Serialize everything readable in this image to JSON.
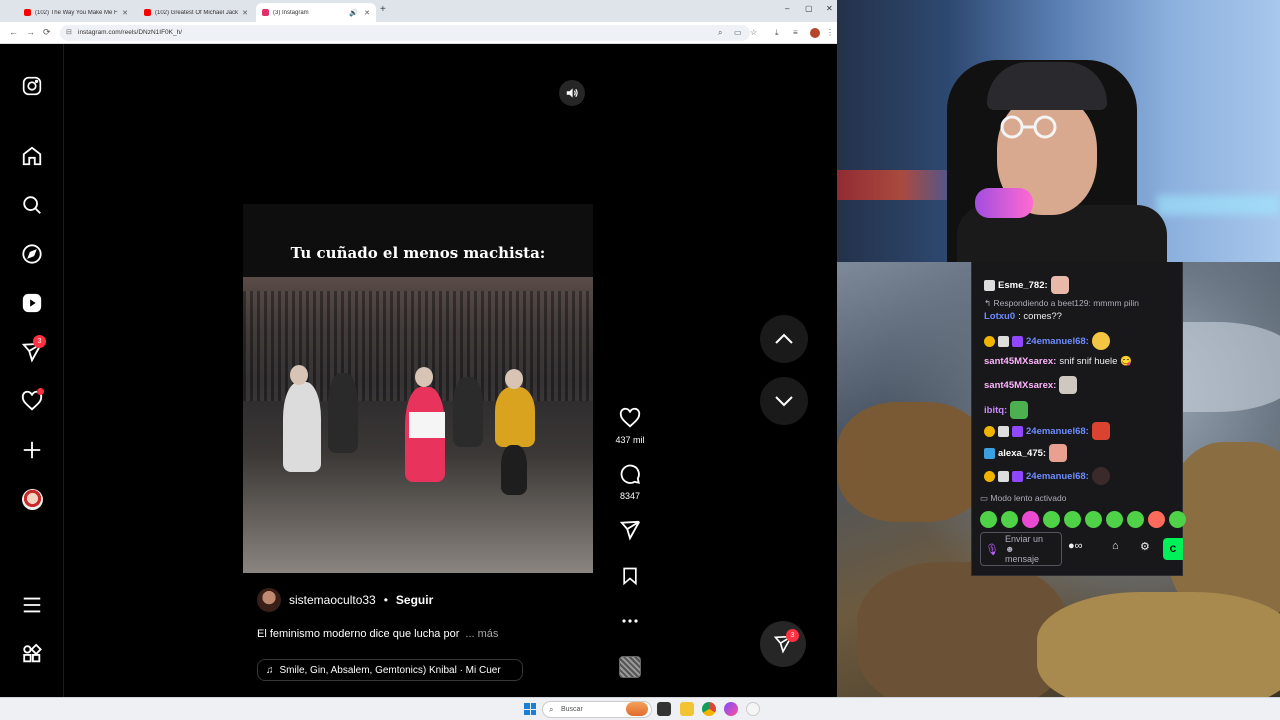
{
  "browser": {
    "tabs": [
      {
        "title": "(102) The Way You Make Me Fe",
        "color": "#ff0000",
        "active": false
      },
      {
        "title": "(102) Greatest Of Michael Jackso",
        "color": "#ff0000",
        "active": false
      },
      {
        "title": "(3) Instagram",
        "color": "#e1306c",
        "active": true
      }
    ],
    "new_tab": "+",
    "window_controls": {
      "minimize": "–",
      "maximize": "▢",
      "close": "✕"
    },
    "url": "instagram.com/reels/DNzN1IF0K_h/"
  },
  "instagram": {
    "nav": [
      {
        "name": "instagram-logo-icon"
      },
      {
        "name": "home-icon"
      },
      {
        "name": "search-icon"
      },
      {
        "name": "explore-icon"
      },
      {
        "name": "reels-icon"
      },
      {
        "name": "messages-icon",
        "badge": "3"
      },
      {
        "name": "notifications-icon"
      },
      {
        "name": "create-icon"
      },
      {
        "name": "profile-avatar"
      },
      {
        "name": "more-menu-icon"
      },
      {
        "name": "also-from-meta-icon"
      }
    ],
    "reel": {
      "overlay_title": "Tu cuñado el menos machista:",
      "author": "sistemaoculto33",
      "separator": "•",
      "follow_label": "Seguir",
      "description": "El feminismo moderno dice que lucha por",
      "more_label": "... más",
      "audio_label": "Smile, Gin, Absalem, Gemtonics)  Knibal · Mi Cuer"
    },
    "actions": {
      "likes": "437 mil",
      "comments": "8347"
    },
    "floating_messages_badge": "3"
  },
  "stream_chat": {
    "messages": [
      {
        "type": "msg",
        "user": "Esme_782:",
        "color": "#ffffff",
        "text": ""
      },
      {
        "type": "reply",
        "text": "↰ Respondiendo a beet129: mmmm pilin"
      },
      {
        "type": "msg",
        "user": "Lotxu0",
        "color": "#6e8cff",
        "text": ": comes??"
      },
      {
        "type": "msg",
        "user": "24emanuel68:",
        "color": "#6e8cff",
        "text": ""
      },
      {
        "type": "msg",
        "user": "sant45MXsarex:",
        "color": "#ffb3ff",
        "text": " snif snif huele 😋"
      },
      {
        "type": "msg",
        "user": "sant45MXsarex:",
        "color": "#ffb3ff",
        "text": ""
      },
      {
        "type": "msg",
        "user": "ibitq:",
        "color": "#c98bff",
        "text": ""
      },
      {
        "type": "msg",
        "user": "24emanuel68:",
        "color": "#6e8cff",
        "text": ""
      },
      {
        "type": "msg",
        "user": "alexa_475:",
        "color": "#ffffff",
        "text": ""
      },
      {
        "type": "msg",
        "user": "24emanuel68:",
        "color": "#6e8cff",
        "text": ""
      }
    ],
    "slow_mode": "Modo lento activado",
    "input_placeholder": "Enviar un ☻ mensaje",
    "send_label": "C"
  },
  "taskbar": {
    "search_placeholder": "Buscar"
  }
}
